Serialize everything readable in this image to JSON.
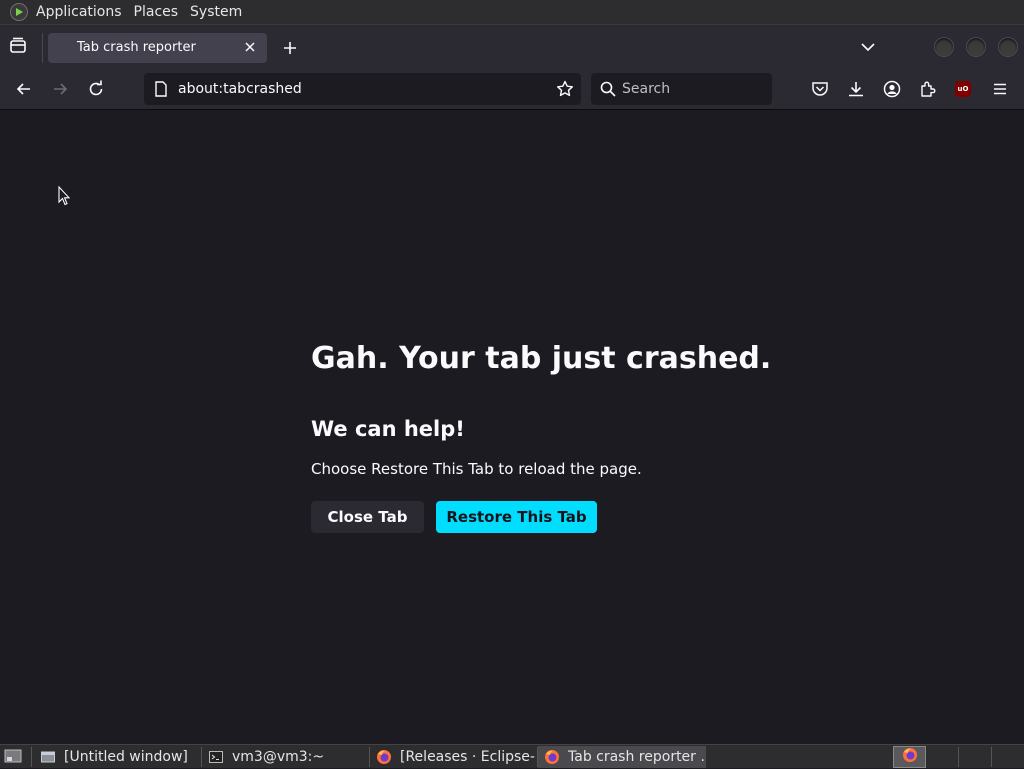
{
  "top_panel": {
    "menus": [
      "Applications",
      "Places",
      "System"
    ]
  },
  "tabs": {
    "active_title": "Tab crash reporter"
  },
  "navbar": {
    "url": "about:tabcrashed",
    "search_placeholder": "Search",
    "ublock_label": "uO"
  },
  "content": {
    "title": "Gah. Your tab just crashed.",
    "subtitle": "We can help!",
    "description": "Choose Restore This Tab to reload the page.",
    "close_button": "Close Tab",
    "restore_button": "Restore This Tab"
  },
  "taskbar": {
    "items": [
      {
        "label": "[Untitled window]",
        "icon": "window-icon"
      },
      {
        "label": "vm3@vm3:~",
        "icon": "terminal-icon"
      },
      {
        "label": "[Releases · Eclipse-…",
        "icon": "firefox-icon"
      },
      {
        "label": "Tab crash reporter …",
        "icon": "firefox-icon"
      }
    ]
  },
  "colors": {
    "accent": "#00ddff",
    "background": "#1c1b22",
    "toolbar": "#2b2a33"
  }
}
